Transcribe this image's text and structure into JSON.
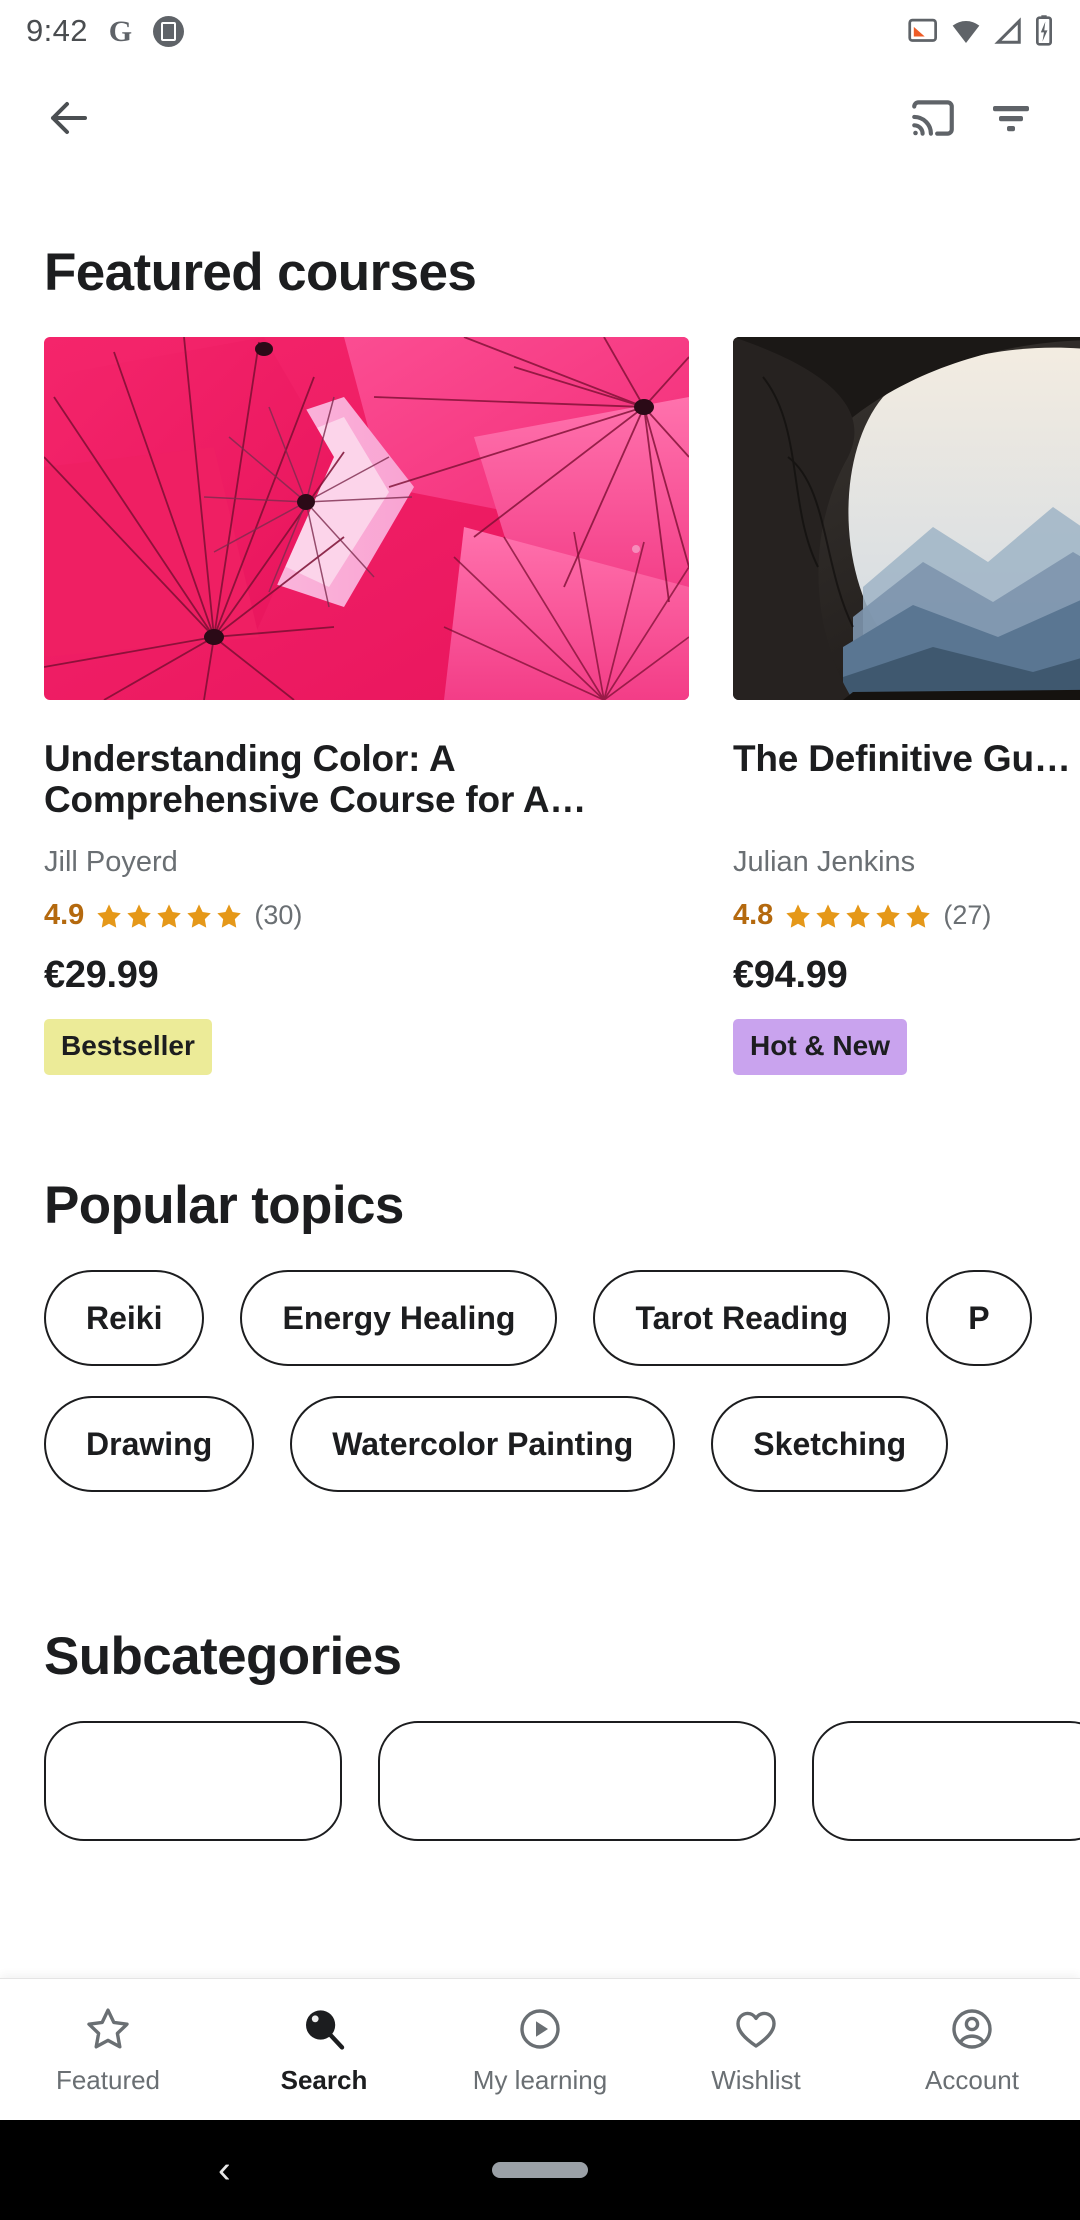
{
  "status_bar": {
    "time": "9:42",
    "left_icons": [
      "google-icon",
      "screenshot-icon"
    ],
    "right_icons": [
      "cast-active-icon",
      "wifi-icon",
      "cellular-signal-icon",
      "battery-charging-icon"
    ]
  },
  "app_bar": {
    "back_icon": "back-arrow-icon",
    "cast_icon": "cast-icon",
    "filter_icon": "filter-icon"
  },
  "featured": {
    "title": "Featured courses",
    "courses": [
      {
        "image": "pink-umbrellas",
        "title": "Understanding Color: A Comprehensive Course for A…",
        "author": "Jill Poyerd",
        "rating": "4.9",
        "stars": 5,
        "reviews": "(30)",
        "price": "€29.99",
        "badge": "Bestseller",
        "badge_color": "#ECEB98"
      },
      {
        "image": "cave-mountains",
        "title": "The Definitive Gu… Empathic Life",
        "author": "Julian Jenkins",
        "rating": "4.8",
        "stars": 5,
        "reviews": "(27)",
        "price": "€94.99",
        "badge": "Hot & New",
        "badge_color": "#C9A3EE"
      }
    ]
  },
  "popular_topics": {
    "title": "Popular topics",
    "row1": [
      "Reiki",
      "Energy Healing",
      "Tarot Reading",
      "P"
    ],
    "row2": [
      "Drawing",
      "Watercolor Painting",
      "Sketching"
    ]
  },
  "subcategories": {
    "title": "Subcategories",
    "items": [
      "",
      "",
      ""
    ]
  },
  "bottom_nav": {
    "items": [
      {
        "label": "Featured",
        "icon": "star-icon",
        "active": false
      },
      {
        "label": "Search",
        "icon": "search-icon",
        "active": true
      },
      {
        "label": "My learning",
        "icon": "play-circle-icon",
        "active": false
      },
      {
        "label": "Wishlist",
        "icon": "heart-icon",
        "active": false
      },
      {
        "label": "Account",
        "icon": "account-circle-icon",
        "active": false
      }
    ]
  },
  "system_nav": {
    "back": "‹",
    "home_pill": "home-pill"
  },
  "colors": {
    "text": "#1c1d1f",
    "muted": "#6a6f73",
    "rating": "#b4690e",
    "star": "#e59819",
    "bestseller_bg": "#ECEB98",
    "hotnew_bg": "#C9A3EE"
  }
}
